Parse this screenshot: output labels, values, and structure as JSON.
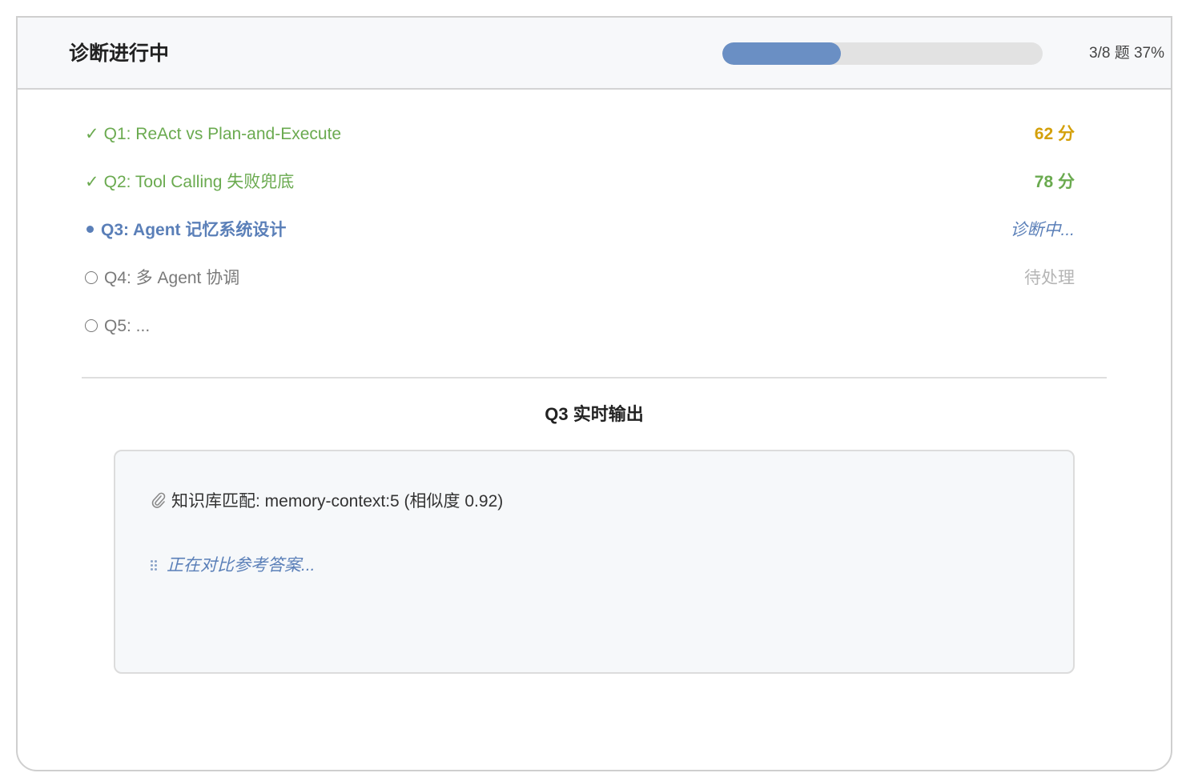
{
  "header": {
    "title": "诊断进行中",
    "progress_text": "3/8 题 37%",
    "progress_percent": 37
  },
  "questions": [
    {
      "mark": "✓",
      "label": "Q1: ReAct vs Plan-and-Execute",
      "status": "62 分"
    },
    {
      "mark": "✓",
      "label": "Q2: Tool Calling 失败兜底",
      "status": "78 分"
    },
    {
      "label": "Q3: Agent 记忆系统设计",
      "status": "诊断中..."
    },
    {
      "label": "Q4: 多 Agent 协调",
      "status": "待处理"
    },
    {
      "label": "Q5: ...",
      "status": ""
    }
  ],
  "output": {
    "title": "Q3 实时输出",
    "line1": "知识库匹配: memory-context:5 (相似度 0.92)",
    "line2": "正在对比参考答案..."
  },
  "colors": {
    "accent": "#6a8fc4",
    "done": "#6aaa4f",
    "score_warn": "#d4a00a",
    "pending": "#b5b5b5"
  },
  "icons": {
    "done": "check-icon",
    "active": "dot-icon",
    "pending": "circle-icon",
    "attachment": "paperclip-icon",
    "loading": "spinner-icon"
  }
}
